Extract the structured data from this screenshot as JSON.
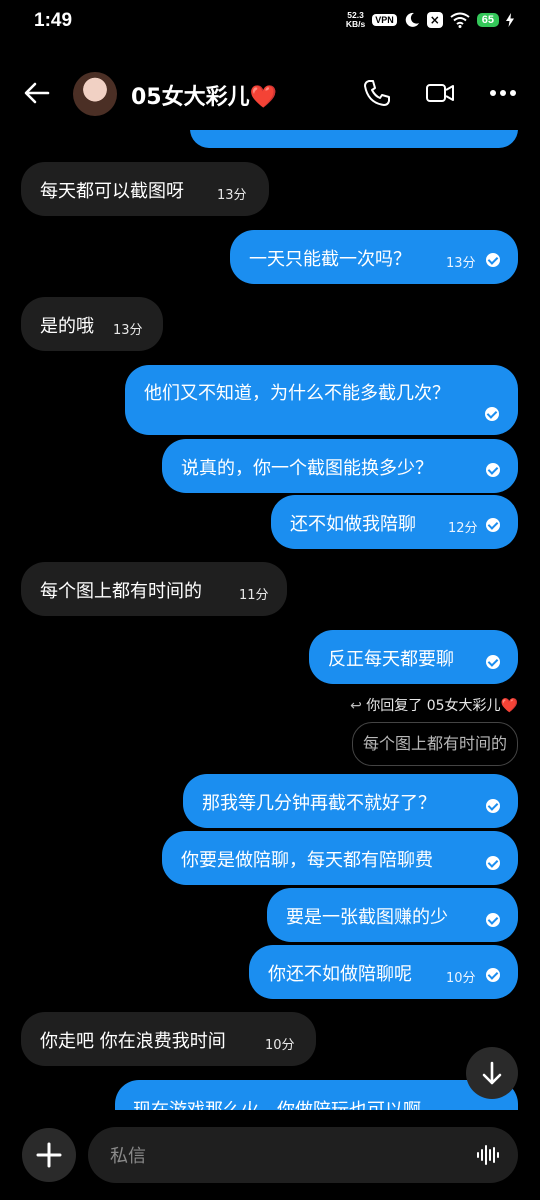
{
  "status": {
    "time": "1:49",
    "net_speed": "52.3",
    "net_unit": "KB/s",
    "vpn": "VPN",
    "battery": "65"
  },
  "header": {
    "title": "05女大彩儿❤️"
  },
  "messages": [
    {
      "dir": "in",
      "text": "每天都可以截图呀",
      "time": "13分"
    },
    {
      "dir": "out",
      "text": "一天只能截一次吗？",
      "time": "13分",
      "read": true
    },
    {
      "dir": "in",
      "text": "是的哦",
      "time": "13分"
    },
    {
      "dir": "out",
      "text": "他们又不知道，为什么不能多截几次？",
      "read": true
    },
    {
      "dir": "out",
      "text": "说真的，你一个截图能换多少？",
      "read": true
    },
    {
      "dir": "out",
      "text": "还不如做我陪聊",
      "time": "12分",
      "read": true
    },
    {
      "dir": "in",
      "text": "每个图上都有时间的",
      "time": "11分"
    },
    {
      "dir": "out",
      "text": "反正每天都要聊",
      "read": true
    },
    {
      "dir": "out",
      "text": "那我等几分钟再截不就好了？",
      "read": true
    },
    {
      "dir": "out",
      "text": "你要是做陪聊，每天都有陪聊费",
      "read": true
    },
    {
      "dir": "out",
      "text": "要是一张截图赚的少",
      "read": true
    },
    {
      "dir": "out",
      "text": "你还不如做陪聊呢",
      "time": "10分",
      "read": true
    },
    {
      "dir": "in",
      "text": "你走吧 你在浪费我时间",
      "time": "10分"
    },
    {
      "dir": "out",
      "text": "现在游戏那么火，你做陪玩也可以啊"
    }
  ],
  "reply": {
    "note": "你回复了 05女大彩儿❤️",
    "quote": "每个图上都有时间的"
  },
  "composer": {
    "placeholder": "私信"
  }
}
